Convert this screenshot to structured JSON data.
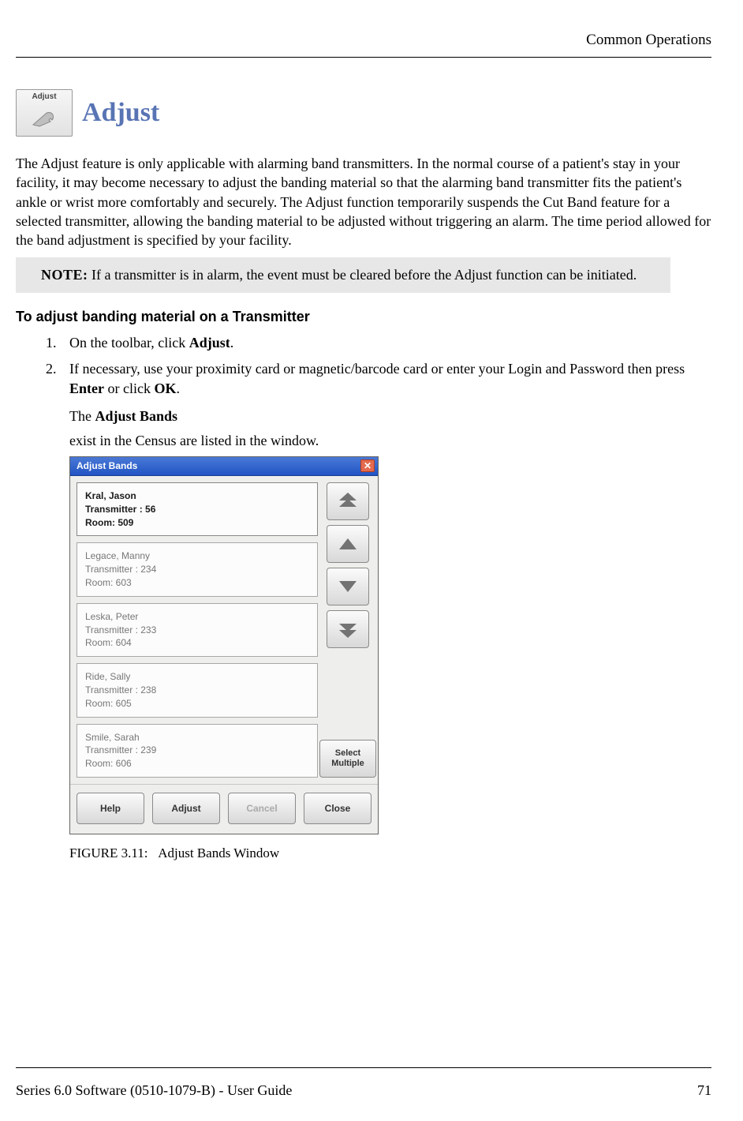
{
  "header": {
    "section": "Common Operations"
  },
  "title": {
    "icon_label": "Adjust",
    "text": "Adjust"
  },
  "paragraph": "The Adjust feature is only applicable with alarming band transmitters. In the normal course of a patient's stay in your facility, it may become necessary to adjust the banding material so that the alarming band transmitter fits the patient's ankle or wrist more comfortably and securely. The Adjust function temporarily suspends the Cut Band feature for a selected transmitter, allowing the banding material to be adjusted without triggering an alarm. The time period allowed for the band adjustment is specified by your facility.",
  "note": {
    "label": "NOTE:",
    "text": " If a transmitter is in alarm, the event must be cleared before the Adjust function can be initiated."
  },
  "subhead": "To adjust banding material on a Transmitter",
  "steps": {
    "s1_pre": "On the toolbar, click ",
    "s1_bold": "Adjust",
    "s1_post": ".",
    "s2_a": "If necessary, use your proximity card or magnetic/barcode card or enter your Login and Password then press ",
    "s2_enter": "Enter",
    "s2_mid": " or click ",
    "s2_ok": "OK",
    "s2_post": ".",
    "cont1_pre": "The ",
    "cont1_bold": "Adjust Bands",
    "cont2": "exist in the Census are listed in the window."
  },
  "dialog": {
    "title": "Adjust Bands",
    "items": [
      {
        "name": "Kral, Jason",
        "tx": "Transmitter : 56",
        "room": "Room: 509",
        "selected": true
      },
      {
        "name": "Legace, Manny",
        "tx": "Transmitter : 234",
        "room": "Room: 603",
        "selected": false
      },
      {
        "name": "Leska, Peter",
        "tx": "Transmitter : 233",
        "room": "Room: 604",
        "selected": false
      },
      {
        "name": "Ride, Sally",
        "tx": "Transmitter : 238",
        "room": "Room: 605",
        "selected": false
      },
      {
        "name": "Smile, Sarah",
        "tx": "Transmitter : 239",
        "room": "Room: 606",
        "selected": false
      }
    ],
    "select_multiple": "Select Multiple",
    "buttons": {
      "help": "Help",
      "adjust": "Adjust",
      "cancel": "Cancel",
      "close": "Close"
    }
  },
  "figure_caption": {
    "label": "FIGURE 3.11:",
    "text": "Adjust Bands Window"
  },
  "footer": {
    "left": "Series 6.0 Software (0510-1079-B) - User Guide",
    "right": "71"
  }
}
